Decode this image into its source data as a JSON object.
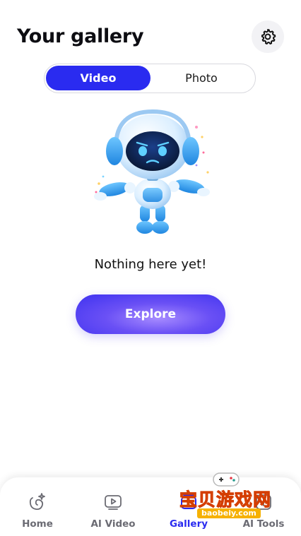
{
  "header": {
    "title": "Your gallery",
    "settings_icon": "gear-icon"
  },
  "segment": {
    "options": [
      {
        "label": "Video",
        "selected": true
      },
      {
        "label": "Photo",
        "selected": false
      }
    ]
  },
  "empty_state": {
    "illustration": "robot-shrug-illustration",
    "message": "Nothing here yet!",
    "action_label": "Explore"
  },
  "bottom_nav": {
    "items": [
      {
        "label": "Home",
        "icon": "sparkle-shape-icon",
        "active": false
      },
      {
        "label": "AI Video",
        "icon": "video-play-icon",
        "active": false
      },
      {
        "label": "Gallery",
        "icon": "gallery-icon",
        "active": true
      },
      {
        "label": "AI Tools",
        "icon": "tools-icon",
        "active": false
      }
    ]
  },
  "watermark": {
    "brand": "宝贝游戏网",
    "url": "baobeiy.com"
  },
  "colors": {
    "accent": "#2a2bf0",
    "explore_gradient_start": "#3e32f0",
    "explore_gradient_mid": "#6a50f5",
    "nav_inactive": "#6b6b73"
  }
}
